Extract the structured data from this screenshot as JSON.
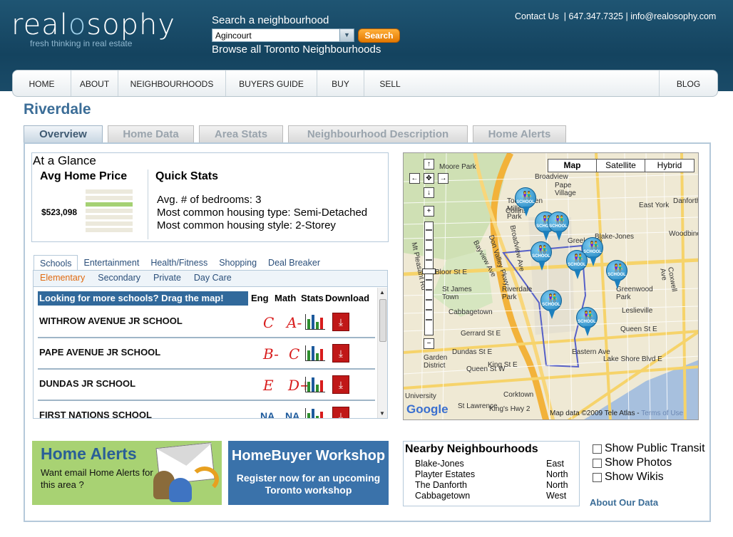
{
  "header": {
    "logo_pre": "real",
    "logo_o": "o",
    "logo_post": "sophy",
    "tagline": "fresh thinking in real estate",
    "search_label": "Search a neighbourhood",
    "select_value": "Agincourt",
    "search_button": "Search",
    "browse_link": "Browse all Toronto Neighbourhoods",
    "contact": "Contact Us",
    "phone": "| 647.347.7325 |",
    "email": "info@realosophy.com"
  },
  "nav": [
    {
      "label": "HOME",
      "name": "nav-home"
    },
    {
      "label": "ABOUT",
      "name": "nav-about"
    },
    {
      "label": "NEIGHBOURHOODS",
      "name": "nav-neighbourhoods"
    },
    {
      "label": "BUYERS GUIDE",
      "name": "nav-buyers-guide"
    },
    {
      "label": "BUY",
      "name": "nav-buy"
    },
    {
      "label": "SELL",
      "name": "nav-sell"
    },
    {
      "label": "BLOG",
      "name": "nav-blog"
    }
  ],
  "page_title": "Riverdale",
  "tabs": [
    {
      "label": "Overview",
      "active": true
    },
    {
      "label": "Home Data",
      "active": false
    },
    {
      "label": "Area Stats",
      "active": false
    },
    {
      "label": "Neighbourhood Description",
      "active": false
    },
    {
      "label": "Home Alerts",
      "active": false
    }
  ],
  "glance": {
    "title": "At a Glance",
    "avg_title": "Avg Home Price",
    "avg_price": "$523,098",
    "price_level": 0.33,
    "qs_title": "Quick Stats",
    "qs_items": [
      "Avg. # of bedrooms: 3",
      "Most common housing type: Semi-Detached",
      "Most common housing style: 2-Storey"
    ]
  },
  "category_tabs": [
    {
      "label": "Schools",
      "active": true
    },
    {
      "label": "Entertainment",
      "active": false
    },
    {
      "label": "Health/Fitness",
      "active": false
    },
    {
      "label": "Shopping",
      "active": false
    },
    {
      "label": "Deal Breaker",
      "active": false
    }
  ],
  "school_subtabs": [
    {
      "label": "Elementary",
      "active": true
    },
    {
      "label": "Secondary",
      "active": false
    },
    {
      "label": "Private",
      "active": false
    },
    {
      "label": "Day Care",
      "active": false
    }
  ],
  "schools": {
    "drag_hint": "Looking for more schools? Drag the map!",
    "col_eng": "Eng",
    "col_math": "Math",
    "col_stats": "Stats",
    "col_download": "Download",
    "rows": [
      {
        "name": "WITHROW AVENUE JR SCHOOL",
        "eng": "C",
        "math": "A-"
      },
      {
        "name": "PAPE AVENUE JR SCHOOL",
        "eng": "B-",
        "math": "C"
      },
      {
        "name": "DUNDAS JR SCHOOL",
        "eng": "E",
        "math": "D+"
      },
      {
        "name": "FIRST NATIONS SCHOOL",
        "eng": "NA",
        "math": "NA"
      }
    ]
  },
  "map": {
    "types": [
      {
        "label": "Map",
        "active": true
      },
      {
        "label": "Satellite",
        "active": false
      },
      {
        "label": "Hybrid",
        "active": false
      }
    ],
    "pin_label": "SCHOOL",
    "labels": [
      "Moore Park",
      "Broadview",
      "Pape Village",
      "East York",
      "Todmorden Mills Park",
      "Bayview Ave",
      "Don Valley Pkwy",
      "Broadview Ave",
      "Mt Pleasant Rd",
      "Bloor St E",
      "St James Town",
      "Riverdale Park",
      "Cabbagetown",
      "Gerrard St E",
      "Greektown",
      "Blake-Jones",
      "Greenwood Park",
      "Leslieville",
      "Queen St E",
      "Dundas St E",
      "Garden District",
      "Queen St W",
      "King St E",
      "Eastern Ave",
      "Lake Shore Blvd E",
      "Corktown",
      "St Lawrence",
      "University",
      "King's Hwy 2",
      "Danforth",
      "Woodbine",
      "Coxwell Ave",
      "Collins"
    ],
    "attribution": "Map data ©2009 Tele Atlas -",
    "terms": "Terms of Use",
    "google": "Google"
  },
  "home_alerts": {
    "title": "Home Alerts",
    "text": "Want email Home Alerts for this area ?"
  },
  "workshop": {
    "title": "HomeBuyer Workshop",
    "text": "Register now for an upcoming Toronto workshop"
  },
  "nearby": {
    "title": "Nearby Neighbourhoods",
    "items": [
      {
        "name": "Blake-Jones",
        "dir": "East"
      },
      {
        "name": "Playter Estates",
        "dir": "North"
      },
      {
        "name": "The Danforth",
        "dir": "North"
      },
      {
        "name": "Cabbagetown",
        "dir": "West"
      }
    ]
  },
  "overlays": [
    "Show Public Transit",
    "Show Photos",
    "Show Wikis"
  ],
  "about_data": "About Our Data",
  "colors": {
    "brand": "#1f5573",
    "accent": "#e37800",
    "title": "#3b6d97",
    "grade_red": "#d81c1c",
    "grade_na": "#1d5a9c"
  }
}
